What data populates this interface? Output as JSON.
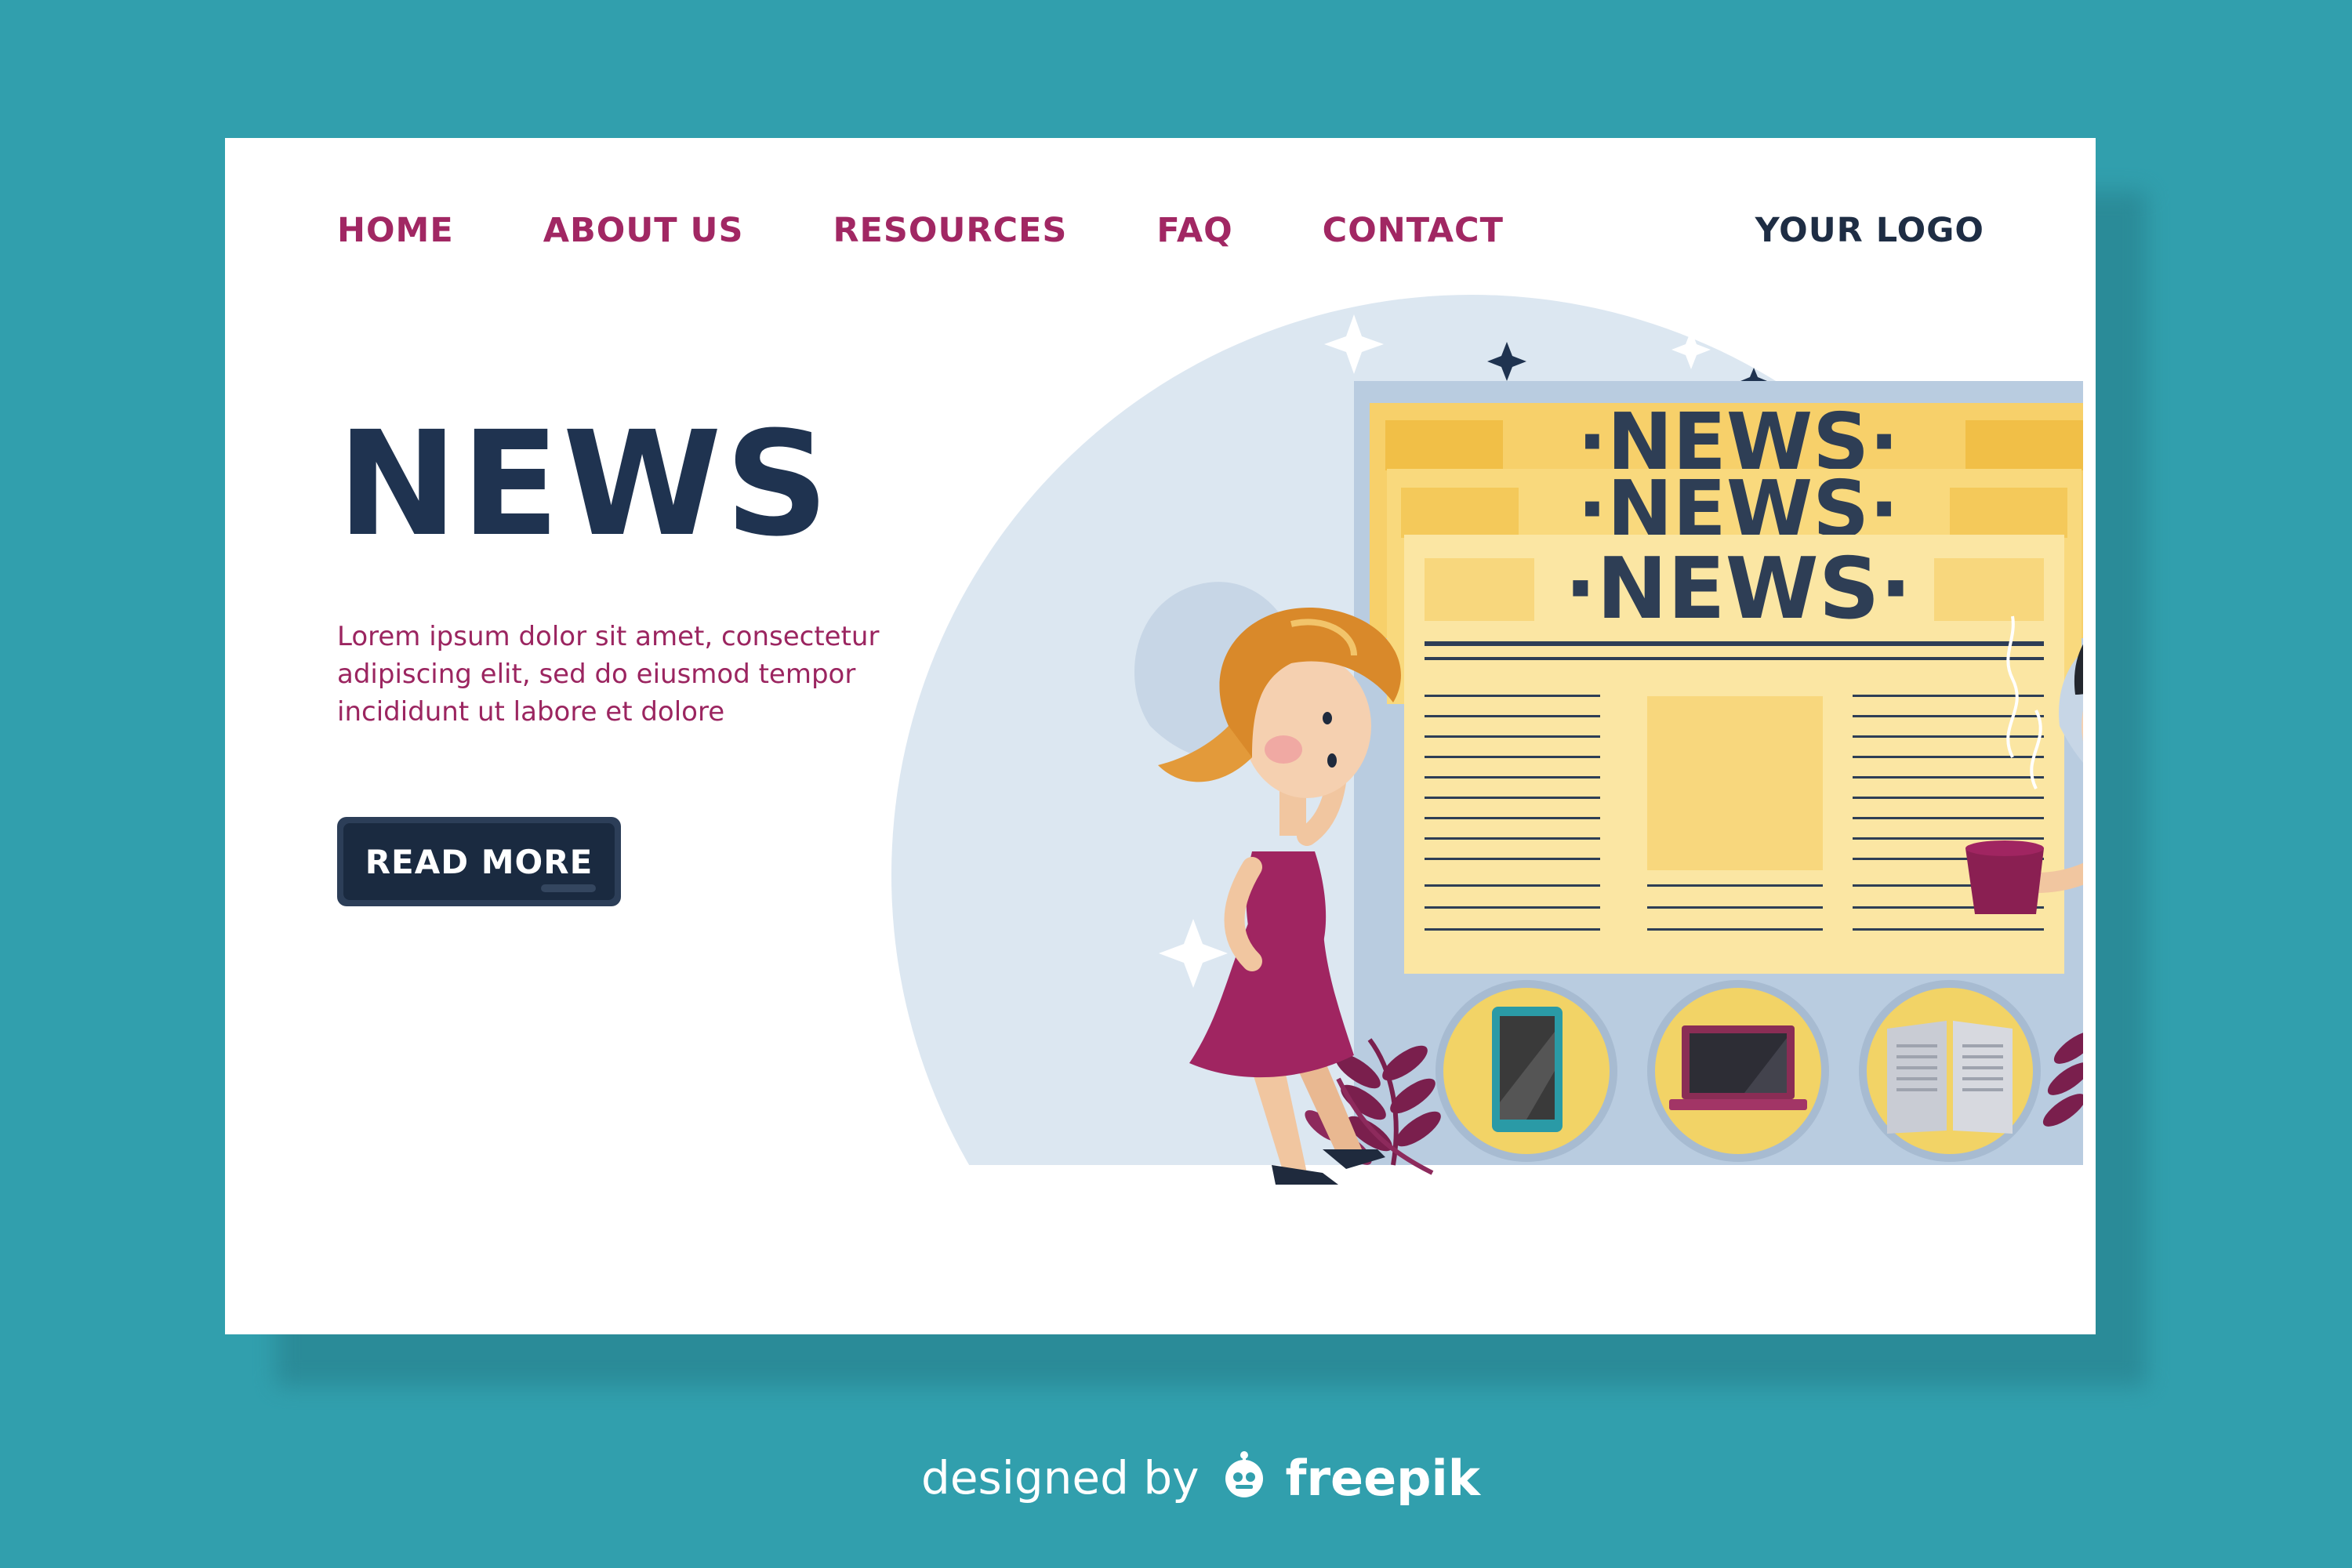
{
  "nav": {
    "items": [
      {
        "label": "HOME"
      },
      {
        "label": "ABOUT US"
      },
      {
        "label": "RESOURCES"
      },
      {
        "label": "FAQ"
      },
      {
        "label": "CONTACT"
      }
    ],
    "logo": "YOUR LOGO"
  },
  "hero": {
    "title": "NEWS",
    "body": "Lorem ipsum dolor sit amet, consectetur adipiscing elit, sed do eiusmod tempor incididunt ut labore et dolore",
    "cta_label": "READ MORE"
  },
  "illustration": {
    "newspaper_headline": "NEWS",
    "device_icons": [
      "smartphone-icon",
      "laptop-icon",
      "newspaper-icon"
    ]
  },
  "credit": {
    "prefix": "designed by",
    "brand": "freepik"
  },
  "colors": {
    "background": "#319fad",
    "card": "#ffffff",
    "nav_link": "#a12763",
    "title": "#1f3350",
    "body_text": "#9b2560",
    "button": "#1a2a40"
  }
}
